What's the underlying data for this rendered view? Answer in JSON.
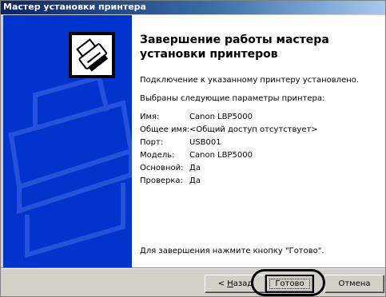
{
  "window": {
    "title": "Мастер установки принтера"
  },
  "content": {
    "heading": "Завершение работы мастера установки принтеров",
    "connected_text": "Подключение к указанному принтеру установлено.",
    "params_intro": "Выбраны следующие параметры принтера:",
    "params": [
      {
        "label": "Имя:",
        "value": "Canon LBP5000"
      },
      {
        "label": "Общее имя:",
        "value": "<Общий доступ отсутствует>"
      },
      {
        "label": "Порт:",
        "value": "USB001"
      },
      {
        "label": "Модель:",
        "value": "Canon LBP5000"
      },
      {
        "label": "Основной:",
        "value": "Да"
      },
      {
        "label": "Проверка:",
        "value": "Да"
      }
    ],
    "finish_hint": "Для завершения нажмите кнопку \"Готово\"."
  },
  "buttons": {
    "back_prefix": "< ",
    "back_hotkey": "Н",
    "back_rest": "азад",
    "finish": "Готово",
    "cancel": "Отмена"
  },
  "icons": {
    "wizard_icon": "printer-icon"
  }
}
